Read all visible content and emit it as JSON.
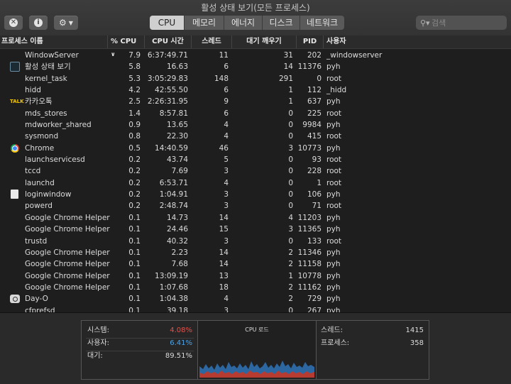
{
  "window": {
    "title": "활성 상태 보기(모든 프로세스)"
  },
  "toolbar": {
    "tabs": [
      "CPU",
      "메모리",
      "에너지",
      "디스크",
      "네트워크"
    ],
    "active_tab": "CPU"
  },
  "search": {
    "placeholder": "검색"
  },
  "columns": {
    "name": "프로세스 이름",
    "cpu": "% CPU",
    "time": "CPU 시간",
    "threads": "스레드",
    "idle_wakeups": "대기 깨우기",
    "pid": "PID",
    "user": "사용자"
  },
  "processes": [
    {
      "icon": "none",
      "name": "WindowServer",
      "cpu": "7.9",
      "time": "6:37:49.71",
      "threads": "11",
      "wake": "31",
      "pid": "202",
      "user": "_windowserver"
    },
    {
      "icon": "activity-monitor-icon",
      "name": "활성 상태 보기",
      "cpu": "5.8",
      "time": "16.63",
      "threads": "6",
      "wake": "14",
      "pid": "11376",
      "user": "pyh"
    },
    {
      "icon": "none",
      "name": "kernel_task",
      "cpu": "5.3",
      "time": "3:05:29.83",
      "threads": "148",
      "wake": "291",
      "pid": "0",
      "user": "root"
    },
    {
      "icon": "none",
      "name": "hidd",
      "cpu": "4.2",
      "time": "42:55.50",
      "threads": "6",
      "wake": "1",
      "pid": "112",
      "user": "_hidd"
    },
    {
      "icon": "kakaotalk-icon",
      "name": "카카오톡",
      "cpu": "2.5",
      "time": "2:26:31.95",
      "threads": "9",
      "wake": "1",
      "pid": "637",
      "user": "pyh"
    },
    {
      "icon": "none",
      "name": "mds_stores",
      "cpu": "1.4",
      "time": "8:57.81",
      "threads": "6",
      "wake": "0",
      "pid": "225",
      "user": "root"
    },
    {
      "icon": "none",
      "name": "mdworker_shared",
      "cpu": "0.9",
      "time": "13.65",
      "threads": "4",
      "wake": "0",
      "pid": "9984",
      "user": "pyh"
    },
    {
      "icon": "none",
      "name": "sysmond",
      "cpu": "0.8",
      "time": "22.30",
      "threads": "4",
      "wake": "0",
      "pid": "415",
      "user": "root"
    },
    {
      "icon": "chrome-icon",
      "name": "Chrome",
      "cpu": "0.5",
      "time": "14:40.59",
      "threads": "46",
      "wake": "3",
      "pid": "10773",
      "user": "pyh"
    },
    {
      "icon": "none",
      "name": "launchservicesd",
      "cpu": "0.2",
      "time": "43.74",
      "threads": "5",
      "wake": "0",
      "pid": "93",
      "user": "root"
    },
    {
      "icon": "none",
      "name": "tccd",
      "cpu": "0.2",
      "time": "7.69",
      "threads": "3",
      "wake": "0",
      "pid": "228",
      "user": "root"
    },
    {
      "icon": "none",
      "name": "launchd",
      "cpu": "0.2",
      "time": "6:53.71",
      "threads": "4",
      "wake": "0",
      "pid": "1",
      "user": "root"
    },
    {
      "icon": "document-icon",
      "name": "loginwindow",
      "cpu": "0.2",
      "time": "1:04.91",
      "threads": "3",
      "wake": "0",
      "pid": "106",
      "user": "pyh"
    },
    {
      "icon": "none",
      "name": "powerd",
      "cpu": "0.2",
      "time": "2:48.74",
      "threads": "3",
      "wake": "0",
      "pid": "71",
      "user": "root"
    },
    {
      "icon": "none",
      "name": "Google Chrome Helper",
      "cpu": "0.1",
      "time": "14.73",
      "threads": "14",
      "wake": "4",
      "pid": "11203",
      "user": "pyh"
    },
    {
      "icon": "none",
      "name": "Google Chrome Helper",
      "cpu": "0.1",
      "time": "24.46",
      "threads": "15",
      "wake": "3",
      "pid": "11365",
      "user": "pyh"
    },
    {
      "icon": "none",
      "name": "trustd",
      "cpu": "0.1",
      "time": "40.32",
      "threads": "3",
      "wake": "0",
      "pid": "133",
      "user": "root"
    },
    {
      "icon": "none",
      "name": "Google Chrome Helper",
      "cpu": "0.1",
      "time": "2.23",
      "threads": "14",
      "wake": "2",
      "pid": "11346",
      "user": "pyh"
    },
    {
      "icon": "none",
      "name": "Google Chrome Helper",
      "cpu": "0.1",
      "time": "7.68",
      "threads": "14",
      "wake": "2",
      "pid": "11158",
      "user": "pyh"
    },
    {
      "icon": "none",
      "name": "Google Chrome Helper",
      "cpu": "0.1",
      "time": "13:09.19",
      "threads": "13",
      "wake": "1",
      "pid": "10778",
      "user": "pyh"
    },
    {
      "icon": "none",
      "name": "Google Chrome Helper",
      "cpu": "0.1",
      "time": "1:07.68",
      "threads": "18",
      "wake": "2",
      "pid": "11162",
      "user": "pyh"
    },
    {
      "icon": "camera-icon",
      "name": "Day-O",
      "cpu": "0.1",
      "time": "1:04.38",
      "threads": "4",
      "wake": "2",
      "pid": "729",
      "user": "pyh"
    },
    {
      "icon": "none",
      "name": "cfprefsd",
      "cpu": "0.1",
      "time": "39.18",
      "threads": "3",
      "wake": "0",
      "pid": "267",
      "user": "pyh"
    }
  ],
  "summary": {
    "system_label": "시스템:",
    "system_value": "4.08%",
    "system_color": "#e8504a",
    "user_label": "사용자:",
    "user_value": "6.41%",
    "user_color": "#4aa3e8",
    "idle_label": "대기:",
    "idle_value": "89.51%",
    "cpu_load_title": "CPU 로드",
    "threads_label": "스레드:",
    "threads_value": "1415",
    "processes_label": "프로세스:",
    "processes_value": "358"
  }
}
